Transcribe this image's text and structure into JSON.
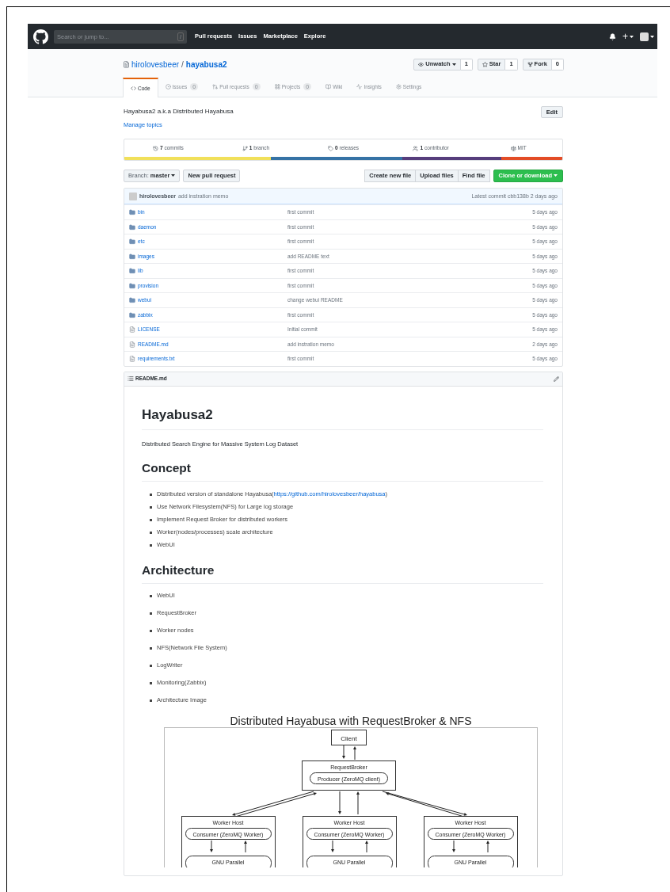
{
  "navbar": {
    "search": {
      "placeholder": "Search or jump to...",
      "shortcut": "/"
    },
    "links": [
      "Pull requests",
      "Issues",
      "Marketplace",
      "Explore"
    ],
    "plus": "+"
  },
  "repo": {
    "owner": "hirolovesbeer",
    "separator": "/",
    "name": "hayabusa2",
    "actions": [
      {
        "kind": "watch",
        "label": "Unwatch",
        "count": "1"
      },
      {
        "kind": "star",
        "label": "Star",
        "count": "1"
      },
      {
        "kind": "fork",
        "label": "Fork",
        "count": "0"
      }
    ]
  },
  "tabs": [
    {
      "kind": "code",
      "label": "Code",
      "selected": true
    },
    {
      "kind": "issues",
      "label": "Issues",
      "count": "0",
      "selected": false
    },
    {
      "kind": "pulls",
      "label": "Pull requests",
      "count": "0",
      "selected": false
    },
    {
      "kind": "projects",
      "label": "Projects",
      "count": "0",
      "selected": false
    },
    {
      "kind": "wiki",
      "label": "Wiki",
      "selected": false
    },
    {
      "kind": "insights",
      "label": "Insights",
      "selected": false
    },
    {
      "kind": "settings",
      "label": "Settings",
      "selected": false
    }
  ],
  "description": "Hayabusa2 a.k.a Distributed Hayabusa",
  "edit_button": "Edit",
  "manage_topics": "Manage topics",
  "stats": [
    {
      "kind": "commits",
      "count": "7",
      "label": "commits"
    },
    {
      "kind": "branch",
      "count": "1",
      "label": "branch"
    },
    {
      "kind": "releases",
      "count": "0",
      "label": "releases"
    },
    {
      "kind": "contributors",
      "count": "1",
      "label": "contributor"
    },
    {
      "kind": "license",
      "label": "MIT"
    }
  ],
  "languages": [
    {
      "color": "#f1e05a"
    },
    {
      "color": "#3572a5"
    },
    {
      "color": "#563d7c"
    },
    {
      "color": "#e34c26"
    }
  ],
  "toolbar": {
    "branch_label": "Branch:",
    "branch": "master",
    "new_pr": "New pull request",
    "file_buttons": [
      "Create new file",
      "Upload files",
      "Find file"
    ],
    "clone": "Clone or download"
  },
  "latest_commit": {
    "author": "hirolovesbeer",
    "message": "add instration memo",
    "summary": "Latest commit cbb138b 2 days ago"
  },
  "files": [
    {
      "kind": "folder",
      "name": "bin",
      "message": "first commit",
      "age": "5 days ago"
    },
    {
      "kind": "folder",
      "name": "daemon",
      "message": "first commit",
      "age": "5 days ago"
    },
    {
      "kind": "folder",
      "name": "etc",
      "message": "first commit",
      "age": "5 days ago"
    },
    {
      "kind": "folder",
      "name": "images",
      "message": "add README text",
      "age": "5 days ago"
    },
    {
      "kind": "folder",
      "name": "lib",
      "message": "first commit",
      "age": "5 days ago"
    },
    {
      "kind": "folder",
      "name": "provision",
      "message": "first commit",
      "age": "5 days ago"
    },
    {
      "kind": "folder",
      "name": "webui",
      "message": "change webui README",
      "age": "5 days ago"
    },
    {
      "kind": "folder",
      "name": "zabbix",
      "message": "first commit",
      "age": "5 days ago"
    },
    {
      "kind": "file",
      "name": "LICENSE",
      "message": "Initial commit",
      "age": "5 days ago"
    },
    {
      "kind": "file",
      "name": "README.md",
      "message": "add instration memo",
      "age": "2 days ago"
    },
    {
      "kind": "file",
      "name": "requirements.txt",
      "message": "first commit",
      "age": "5 days ago"
    }
  ],
  "readme": {
    "filename": "README.md",
    "title": "Hayabusa2",
    "tagline": "Distributed Search Engine for Massive System Log Dataset",
    "concept_heading": "Concept",
    "concept_items": [
      {
        "text": "Distributed version of standalone Hayabusa(",
        "link": "https://github.com/hirolovesbeer/hayabusa",
        "after": ")"
      },
      {
        "text": "Use Network Filesystem(NFS) for Large log storage"
      },
      {
        "text": "Implement Request Broker for distributed workers"
      },
      {
        "text": "Worker(nodes/processes) scale architecture"
      },
      {
        "text": "WebUI"
      }
    ],
    "architecture_heading": "Architecture",
    "architecture_items": [
      "WebUI",
      "RequestBroker",
      "Worker nodes",
      "NFS(Network File System)",
      "LogWriter",
      "Monitoring(Zabbix)",
      "Architecture Image"
    ],
    "diagram": {
      "title": "Distributed Hayabusa with RequestBroker & NFS",
      "client": "Client",
      "broker": "RequestBroker",
      "producer": "Producer (ZeroMQ client)",
      "workers": [
        {
          "title": "Worker Host",
          "consumer": "Consumer (ZeroMQ Worker)",
          "parallel": "GNU Parallel"
        },
        {
          "title": "Worker Host",
          "consumer": "Consumer (ZeroMQ Worker)",
          "parallel": "GNU Parallel"
        },
        {
          "title": "Worker Host",
          "consumer": "Consumer (ZeroMQ Worker)",
          "parallel": "GNU Parallel"
        }
      ]
    }
  }
}
